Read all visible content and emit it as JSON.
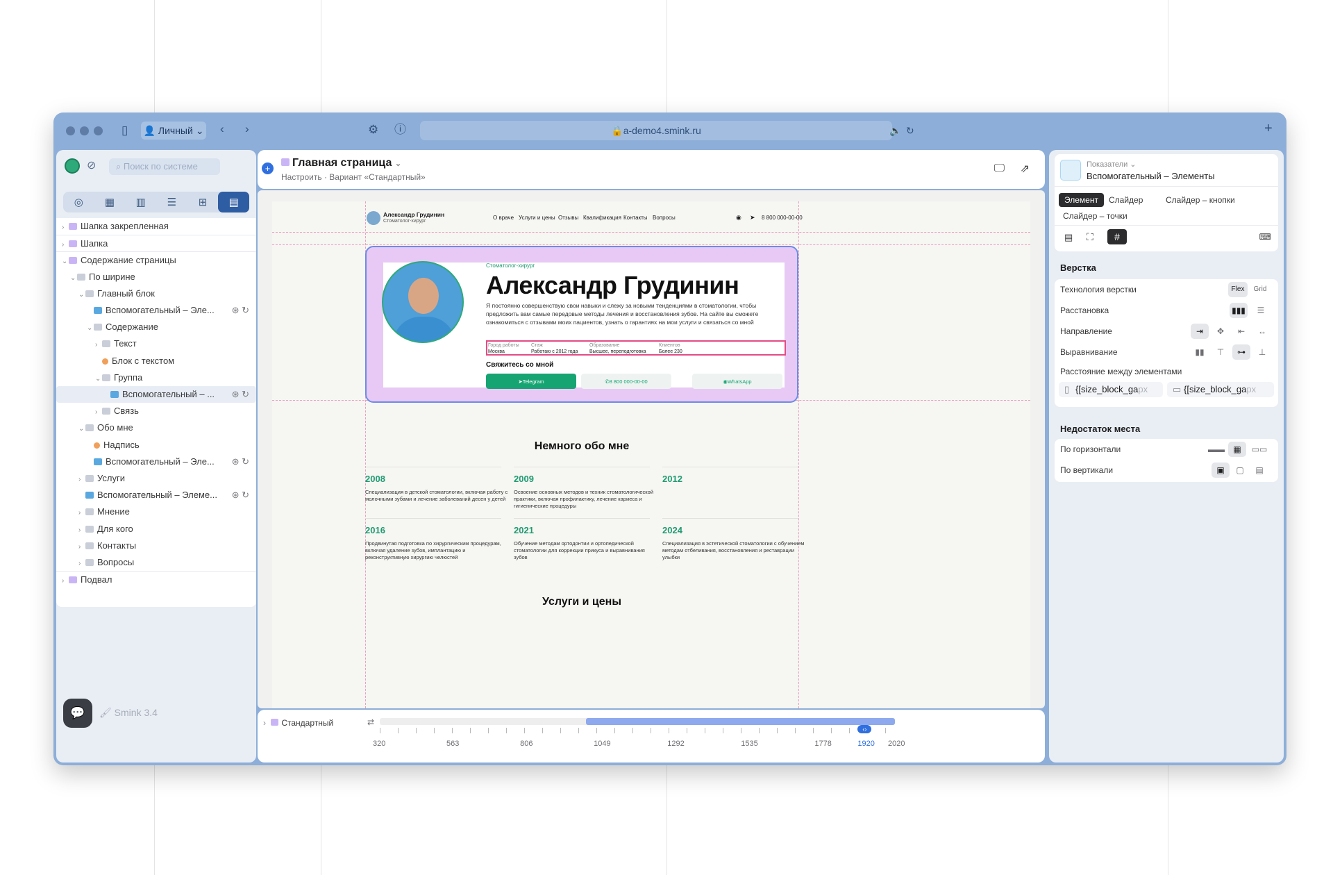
{
  "browser": {
    "profile_label": "Личный",
    "url": "a-demo4.smink.ru"
  },
  "left_panel": {
    "search_placeholder": "Поиск по системе",
    "tree": [
      {
        "label": "Шапка закрепленная",
        "indent": 0,
        "kind": "purple",
        "chevron": "›",
        "actions": false,
        "sep": false,
        "selected": false
      },
      {
        "label": "Шапка",
        "indent": 0,
        "kind": "purple",
        "chevron": "›",
        "actions": false,
        "sep": true,
        "selected": false
      },
      {
        "label": "Содержание страницы",
        "indent": 0,
        "kind": "purple",
        "chevron": "⌄",
        "actions": false,
        "sep": true,
        "selected": false
      },
      {
        "label": "По ширине",
        "indent": 1,
        "kind": "folder",
        "chevron": "⌄",
        "actions": false,
        "sep": false,
        "selected": false
      },
      {
        "label": "Главный блок",
        "indent": 2,
        "kind": "folder",
        "chevron": "⌄",
        "actions": false,
        "sep": false,
        "selected": false
      },
      {
        "label": "Вспомогательный – Эле...",
        "indent": 3,
        "kind": "blue",
        "chevron": "",
        "actions": true,
        "sep": false,
        "selected": false
      },
      {
        "label": "Содержание",
        "indent": 3,
        "kind": "folder",
        "chevron": "⌄",
        "actions": false,
        "sep": false,
        "selected": false
      },
      {
        "label": "Текст",
        "indent": 4,
        "kind": "folder",
        "chevron": "›",
        "actions": false,
        "sep": false,
        "selected": false
      },
      {
        "label": "Блок с текстом",
        "indent": 4,
        "kind": "dot",
        "chevron": "",
        "actions": false,
        "sep": false,
        "selected": false
      },
      {
        "label": "Группа",
        "indent": 4,
        "kind": "folder",
        "chevron": "⌄",
        "actions": false,
        "sep": false,
        "selected": false
      },
      {
        "label": "Вспомогательный – ...",
        "indent": 5,
        "kind": "blue",
        "chevron": "",
        "actions": true,
        "sep": false,
        "selected": true
      },
      {
        "label": "Связь",
        "indent": 4,
        "kind": "folder",
        "chevron": "›",
        "actions": false,
        "sep": false,
        "selected": false
      },
      {
        "label": "Обо мне",
        "indent": 2,
        "kind": "folder",
        "chevron": "⌄",
        "actions": false,
        "sep": false,
        "selected": false
      },
      {
        "label": "Надпись",
        "indent": 3,
        "kind": "dot",
        "chevron": "",
        "actions": false,
        "sep": false,
        "selected": false
      },
      {
        "label": "Вспомогательный – Эле...",
        "indent": 3,
        "kind": "blue",
        "chevron": "",
        "actions": true,
        "sep": false,
        "selected": false
      },
      {
        "label": "Услуги",
        "indent": 2,
        "kind": "folder",
        "chevron": "›",
        "actions": false,
        "sep": false,
        "selected": false
      },
      {
        "label": "Вспомогательный – Элеме...",
        "indent": 2,
        "kind": "blue",
        "chevron": "",
        "actions": true,
        "sep": false,
        "selected": false
      },
      {
        "label": "Мнение",
        "indent": 2,
        "kind": "folder",
        "chevron": "›",
        "actions": false,
        "sep": false,
        "selected": false
      },
      {
        "label": "Для кого",
        "indent": 2,
        "kind": "folder",
        "chevron": "›",
        "actions": false,
        "sep": false,
        "selected": false
      },
      {
        "label": "Контакты",
        "indent": 2,
        "kind": "folder",
        "chevron": "›",
        "actions": false,
        "sep": false,
        "selected": false
      },
      {
        "label": "Вопросы",
        "indent": 2,
        "kind": "folder",
        "chevron": "›",
        "actions": false,
        "sep": false,
        "selected": false
      },
      {
        "label": "Подвал",
        "indent": 0,
        "kind": "purple",
        "chevron": "›",
        "actions": false,
        "sep": true,
        "selected": false
      }
    ],
    "version": "Smink 3.4"
  },
  "header": {
    "title": "Главная страница",
    "subtitle": "Настроить · Вариант «Стандартный»"
  },
  "site": {
    "logo_name": "Александр Грудинин",
    "logo_role": "Стоматолог-хирург",
    "nav": [
      "О враче",
      "Услуги и цены",
      "Отзывы",
      "Квалификация",
      "Контакты",
      "Вопросы"
    ],
    "phone": "8 800 000-00-00",
    "hero": {
      "eyebrow": "Стоматолог-хирург",
      "name": "Александр Грудинин",
      "description": "Я постоянно совершенствую свои навыки и слежу за новыми тенденциями в стоматологии, чтобы предложить вам самые передовые методы лечения и восстановления зубов. На сайте вы сможете ознакомиться с отзывами моих пациентов, узнать о гарантиях на мои услуги и связаться со мной",
      "facts": [
        {
          "key": "Город работы",
          "value": "Москва"
        },
        {
          "key": "Стаж",
          "value": "Работаю с 2012 года"
        },
        {
          "key": "Образование",
          "value": "Высшее, переподготовка"
        },
        {
          "key": "Клиентов",
          "value": "Более 230"
        }
      ],
      "contact_title": "Свяжитесь со мной",
      "buttons": [
        "Telegram",
        "8 800 000-00-00",
        "WhatsApp"
      ]
    },
    "about_title": "Немного обо мне",
    "timeline": [
      {
        "year": "2008",
        "text": "Специализация в детской стоматологии, включая работу с молочными зубами и лечение заболеваний десен у детей"
      },
      {
        "year": "2009",
        "text": "Освоение основных методов и техник стоматологической практики, включая профилактику, лечение кариеса и гигиенические процедуры"
      },
      {
        "year": "2012",
        "text": ""
      },
      {
        "year": "2016",
        "text": "Продвинутая подготовка по хирургическим процедурам, включая удаление зубов, имплантацию и реконструктивную хирургию челюстей"
      },
      {
        "year": "2021",
        "text": "Обучение методам ортодонтии и ортопедической стоматологии для коррекции прикуса и выравнивания зубов"
      },
      {
        "year": "2024",
        "text": "Специализация в эстетической стоматологии с обучением методам отбеливания, восстановления и реставрации улыбки"
      }
    ],
    "services_title": "Услуги и цены"
  },
  "breakpoints": {
    "variant": "Стандартный",
    "ticks": [
      "320",
      "563",
      "806",
      "1049",
      "1292",
      "1535",
      "1778",
      "1920",
      "2020"
    ],
    "range_min": 320,
    "range_max": 2020,
    "active_from": 1000,
    "current": 1920
  },
  "right_panel": {
    "category": "Показатели",
    "element_title": "Вспомогательный – Элементы",
    "tabs": [
      "Элемент",
      "Слайдер",
      "Слайдер – кнопки",
      "Слайдер – точки"
    ],
    "layout_section": "Верстка",
    "layout_tech_label": "Технология верстки",
    "layout_tech_options": [
      "Flex",
      "Grid"
    ],
    "placement_label": "Расстановка",
    "direction_label": "Направление",
    "align_label": "Выравнивание",
    "gap_label": "Расстояние между элементами",
    "gap_value_1": "{[size_block_ga",
    "gap_value_2": "{[size_block_ga",
    "gap_unit": "px",
    "overflow_section": "Недостаток места",
    "horizontal_label": "По горизонтали",
    "vertical_label": "По вертикали"
  },
  "colors": {
    "window": "#8daed8",
    "accent": "#2f6fe0",
    "green": "#1f9b72",
    "selection": "#e34d83"
  }
}
